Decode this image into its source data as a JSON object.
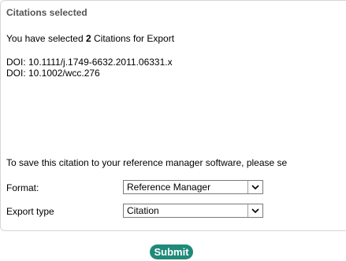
{
  "panel": {
    "title": "Citations selected",
    "selected_prefix": "You have selected ",
    "selected_count": "2",
    "selected_suffix": " Citations for Export",
    "dois": [
      "DOI: 10.1111/j.1749-6632.2011.06331.x",
      "DOI: 10.1002/wcc.276"
    ],
    "info_text": "To save this citation to your reference manager software, please se"
  },
  "form": {
    "format_label": "Format:",
    "format_value": "Reference Manager",
    "export_label": "Export type",
    "export_value": "Citation"
  },
  "icons": {
    "dropdown": "chevron-down-icon"
  },
  "colors": {
    "submit_bg": "#1f8a78",
    "title_text": "#555555",
    "panel_border": "#d6d6d6"
  },
  "submit_label": "Submit"
}
